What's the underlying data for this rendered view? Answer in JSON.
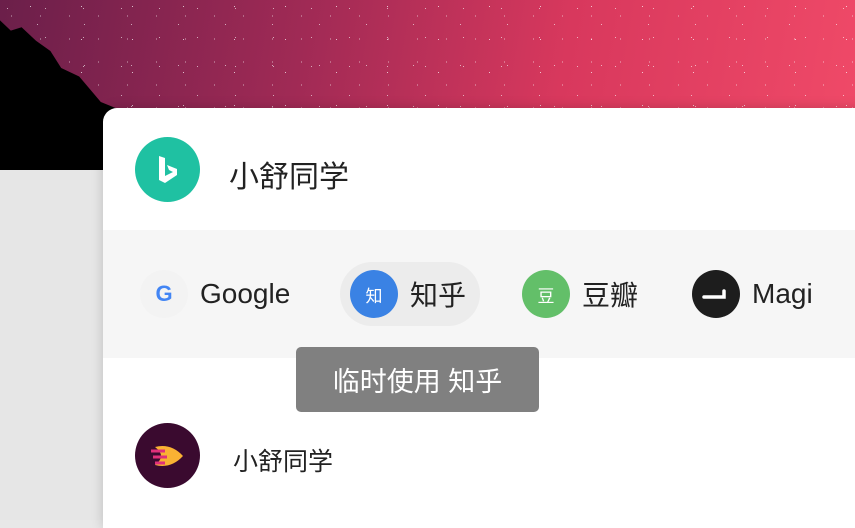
{
  "search": {
    "query": "小舒同学",
    "engine_icon": "bing-icon",
    "engine_color": "#1fc1a2"
  },
  "engines": [
    {
      "label": "Google",
      "icon": "google-icon",
      "color": "#f3f3f3",
      "active": false
    },
    {
      "label": "知乎",
      "icon": "zhihu-icon",
      "icon_text": "知",
      "color": "#3a82e4",
      "active": true
    },
    {
      "label": "豆瓣",
      "icon": "douban-icon",
      "icon_text": "豆",
      "color": "#63bf69",
      "active": false
    },
    {
      "label": "Magi",
      "icon": "magi-icon",
      "color": "#1d1d1d",
      "active": false
    }
  ],
  "tooltip": {
    "text": "临时使用 知乎"
  },
  "suggestion": {
    "text": "小舒同学",
    "icon": "xiaoshu-app-icon",
    "color": "#3a0a2f"
  }
}
